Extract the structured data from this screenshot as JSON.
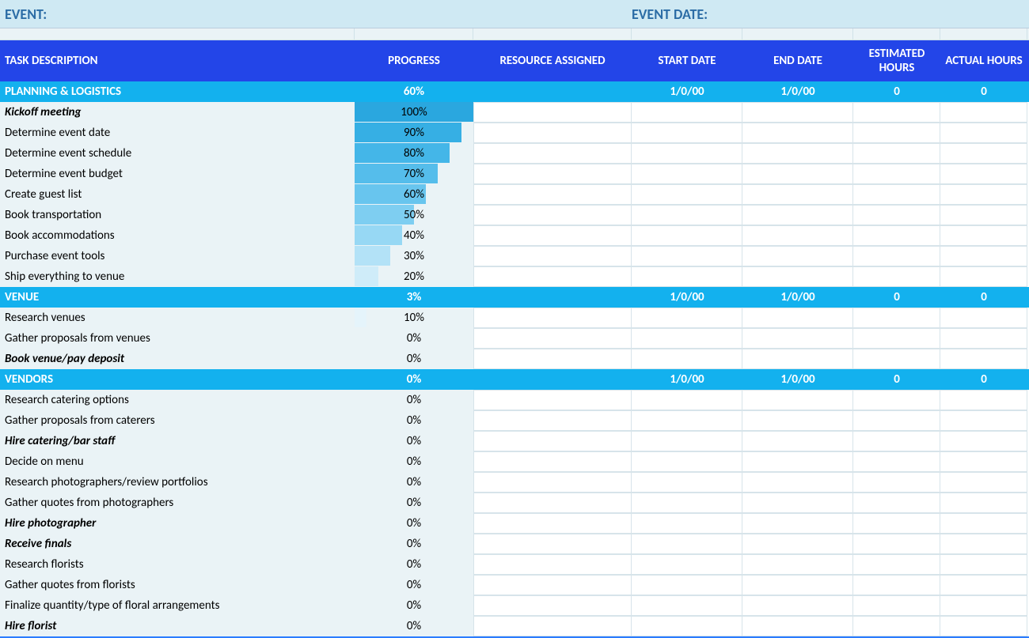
{
  "top": {
    "event_label": "EVENT:",
    "date_label": "EVENT DATE:"
  },
  "headers": {
    "task": "TASK DESCRIPTION",
    "progress": "PROGRESS",
    "resource": "RESOURCE ASSIGNED",
    "start": "START DATE",
    "end": "END DATE",
    "est": "ESTIMATED HOURS",
    "act": "ACTUAL HOURS"
  },
  "groups": [
    {
      "name": "PLANNING & LOGISTICS",
      "progress": "60%",
      "start": "1/0/00",
      "end": "1/0/00",
      "est": "0",
      "act": "0",
      "rows": [
        {
          "task": "Kickoff meeting",
          "progress": "100%",
          "bar": 100,
          "bi": true
        },
        {
          "task": "Determine event date",
          "progress": "90%",
          "bar": 90
        },
        {
          "task": "Determine event schedule",
          "progress": "80%",
          "bar": 80
        },
        {
          "task": "Determine event budget",
          "progress": "70%",
          "bar": 70
        },
        {
          "task": "Create guest list",
          "progress": "60%",
          "bar": 60
        },
        {
          "task": "Book transportation",
          "progress": "50%",
          "bar": 50
        },
        {
          "task": "Book accommodations",
          "progress": "40%",
          "bar": 40
        },
        {
          "task": "Purchase event tools",
          "progress": "30%",
          "bar": 30
        },
        {
          "task": "Ship everything to venue",
          "progress": "20%",
          "bar": 20
        }
      ]
    },
    {
      "name": "VENUE",
      "progress": "3%",
      "start": "1/0/00",
      "end": "1/0/00",
      "est": "0",
      "act": "0",
      "rows": [
        {
          "task": "Research venues",
          "progress": "10%",
          "bar": 10
        },
        {
          "task": "Gather proposals from venues",
          "progress": "0%",
          "bar": 0
        },
        {
          "task": "Book venue/pay deposit",
          "progress": "0%",
          "bar": 0,
          "bi": true
        }
      ]
    },
    {
      "name": "VENDORS",
      "progress": "0%",
      "start": "1/0/00",
      "end": "1/0/00",
      "est": "0",
      "act": "0",
      "rows": [
        {
          "task": "Research catering options",
          "progress": "0%",
          "bar": 0
        },
        {
          "task": "Gather proposals from caterers",
          "progress": "0%",
          "bar": 0
        },
        {
          "task": "Hire catering/bar staff",
          "progress": "0%",
          "bar": 0,
          "bi": true
        },
        {
          "task": "Decide on menu",
          "progress": "0%",
          "bar": 0
        },
        {
          "task": "Research photographers/review portfolios",
          "progress": "0%",
          "bar": 0
        },
        {
          "task": "Gather quotes from photographers",
          "progress": "0%",
          "bar": 0
        },
        {
          "task": "Hire photographer",
          "progress": "0%",
          "bar": 0,
          "bi": true
        },
        {
          "task": "Receive finals",
          "progress": "0%",
          "bar": 0,
          "bi": true
        },
        {
          "task": "Research florists",
          "progress": "0%",
          "bar": 0
        },
        {
          "task": "Gather quotes from florists",
          "progress": "0%",
          "bar": 0
        },
        {
          "task": "Finalize quantity/type of floral arrangements",
          "progress": "0%",
          "bar": 0
        },
        {
          "task": "Hire florist",
          "progress": "0%",
          "bar": 0,
          "bi": true
        }
      ]
    }
  ]
}
